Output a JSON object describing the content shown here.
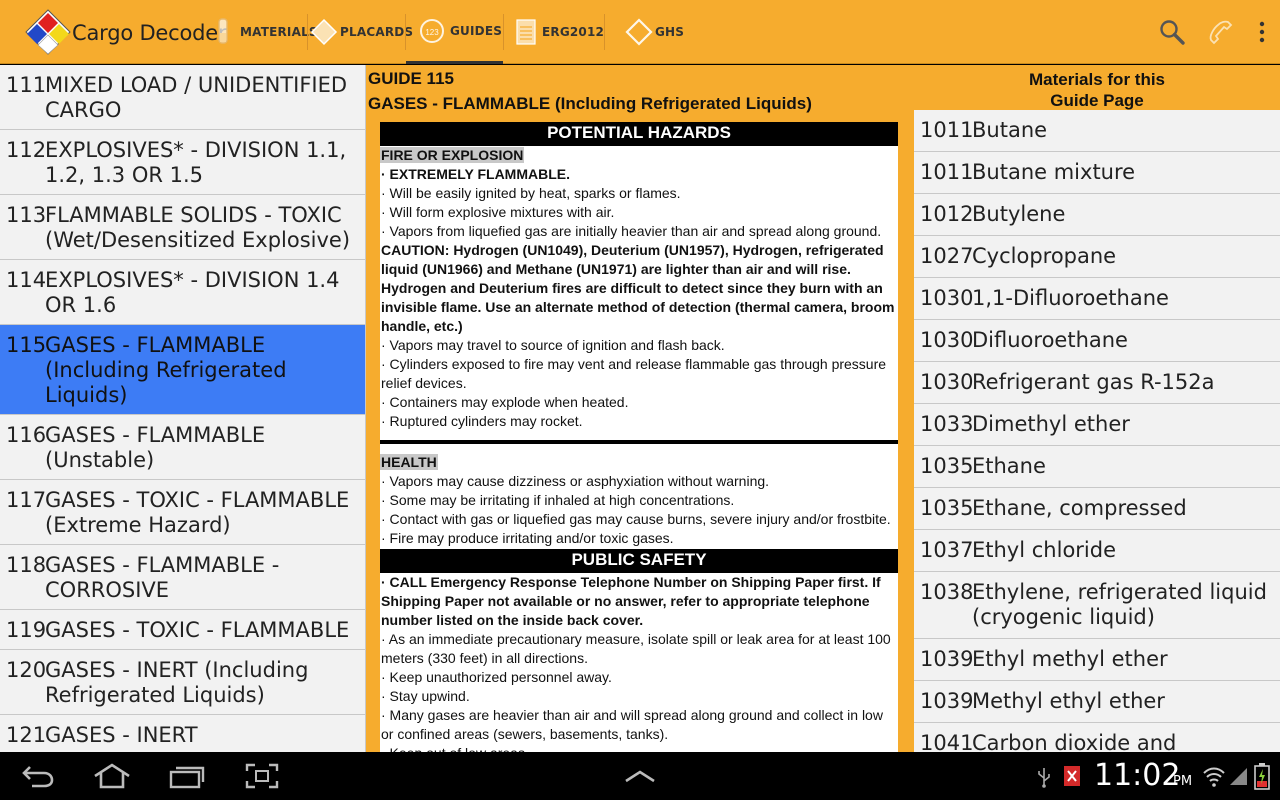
{
  "app": {
    "title": "Cargo Decoder"
  },
  "tabs": [
    {
      "label": "MATERIALS",
      "icon": "vial-icon"
    },
    {
      "label": "PLACARDS",
      "icon": "placard-diamond-icon"
    },
    {
      "label": "GUIDES",
      "icon": "guides-icon",
      "selected": true
    },
    {
      "label": "ERG2012",
      "icon": "notepad-icon"
    },
    {
      "label": "GHS",
      "icon": "ghs-diamond-icon"
    }
  ],
  "actions": {
    "search": "search-icon",
    "call": "phone-icon",
    "overflow": "overflow-menu-icon"
  },
  "guides": [
    {
      "num": "111",
      "name": "MIXED LOAD / UNIDENTIFIED CARGO"
    },
    {
      "num": "112",
      "name": "EXPLOSIVES* - DIVISION 1.1, 1.2, 1.3 OR 1.5"
    },
    {
      "num": "113",
      "name": "FLAMMABLE SOLIDS - TOXIC (Wet/Desensitized Explosive)"
    },
    {
      "num": "114",
      "name": "EXPLOSIVES* - DIVISION 1.4 OR 1.6"
    },
    {
      "num": "115",
      "name": "GASES - FLAMMABLE (Including Refrigerated Liquids)",
      "selected": true
    },
    {
      "num": "116",
      "name": "GASES - FLAMMABLE (Unstable)"
    },
    {
      "num": "117",
      "name": "GASES - TOXIC - FLAMMABLE (Extreme Hazard)"
    },
    {
      "num": "118",
      "name": "GASES - FLAMMABLE - CORROSIVE"
    },
    {
      "num": "119",
      "name": "GASES - TOXIC - FLAMMABLE"
    },
    {
      "num": "120",
      "name": "GASES - INERT (Including Refrigerated Liquids)"
    },
    {
      "num": "121",
      "name": "GASES - INERT"
    }
  ],
  "guide": {
    "number": "GUIDE 115",
    "title": "GASES - FLAMMABLE (Including Refrigerated Liquids)",
    "hazards_header": "POTENTIAL HAZARDS",
    "fire_header": "FIRE OR EXPLOSION",
    "fire_lines": [
      {
        "text": "· EXTREMELY FLAMMABLE.",
        "bold": true
      },
      {
        "text": "· Will be easily ignited by heat, sparks or flames.",
        "bold": false
      },
      {
        "text": "· Will form explosive mixtures with air.",
        "bold": false
      },
      {
        "text": "· Vapors from liquefied gas are initially heavier than air and spread along ground.",
        "bold": false
      },
      {
        "text": "CAUTION: Hydrogen (UN1049), Deuterium (UN1957), Hydrogen, refrigerated liquid (UN1966) and Methane (UN1971) are lighter than air and will rise. Hydrogen and Deuterium fires are difficult to detect since they burn with an invisible flame. Use an alternate method of detection (thermal camera, broom handle, etc.)",
        "bold": true
      },
      {
        "text": "· Vapors may travel to source of ignition and flash back.",
        "bold": false
      },
      {
        "text": "· Cylinders exposed to fire may vent and release flammable gas through pressure relief devices.",
        "bold": false
      },
      {
        "text": "· Containers may explode when heated.",
        "bold": false
      },
      {
        "text": "· Ruptured cylinders may rocket.",
        "bold": false
      }
    ],
    "health_header": "HEALTH",
    "health_lines": [
      {
        "text": "· Vapors may cause dizziness or asphyxiation without warning.",
        "bold": false
      },
      {
        "text": "· Some may be irritating if inhaled at high concentrations.",
        "bold": false
      },
      {
        "text": "· Contact with gas or liquefied gas may cause burns, severe injury and/or frostbite.",
        "bold": false
      },
      {
        "text": "· Fire may produce irritating and/or toxic gases.",
        "bold": false
      }
    ],
    "safety_header": "PUBLIC SAFETY",
    "safety_lines": [
      {
        "text": "· CALL Emergency Response Telephone Number on Shipping Paper first. If Shipping Paper not available or no answer, refer to appropriate telephone number listed on the inside back cover.",
        "bold": true
      },
      {
        "text": "· As an immediate precautionary measure, isolate spill or leak area for at least 100 meters (330 feet) in all directions.",
        "bold": false
      },
      {
        "text": "· Keep unauthorized personnel away.",
        "bold": false
      },
      {
        "text": "· Stay upwind.",
        "bold": false
      },
      {
        "text": "· Many gases are heavier than air and will spread along ground and collect in low or confined areas (sewers, basements, tanks).",
        "bold": false
      },
      {
        "text": "· Keep out of low areas.",
        "bold": false
      }
    ]
  },
  "materials": {
    "title_line1": "Materials for this",
    "title_line2": "Guide Page",
    "items": [
      {
        "un": "1011",
        "name": "Butane"
      },
      {
        "un": "1011",
        "name": "Butane mixture"
      },
      {
        "un": "1012",
        "name": "Butylene"
      },
      {
        "un": "1027",
        "name": "Cyclopropane"
      },
      {
        "un": "1030",
        "name": "1,1-Difluoroethane"
      },
      {
        "un": "1030",
        "name": "Difluoroethane"
      },
      {
        "un": "1030",
        "name": "Refrigerant gas R-152a"
      },
      {
        "un": "1033",
        "name": "Dimethyl ether"
      },
      {
        "un": "1035",
        "name": "Ethane"
      },
      {
        "un": "1035",
        "name": "Ethane, compressed"
      },
      {
        "un": "1037",
        "name": "Ethyl chloride"
      },
      {
        "un": "1038",
        "name": "Ethylene, refrigerated liquid (cryogenic liquid)"
      },
      {
        "un": "1039",
        "name": "Ethyl methyl ether"
      },
      {
        "un": "1039",
        "name": "Methyl ethyl ether"
      },
      {
        "un": "1041",
        "name": "Carbon dioxide and Ethylene oxide mixture, with more than"
      }
    ]
  },
  "system": {
    "time": "11:02",
    "ampm": "PM"
  },
  "colors": {
    "accent": "#f6ac2e",
    "selection": "#3d7cf5"
  }
}
